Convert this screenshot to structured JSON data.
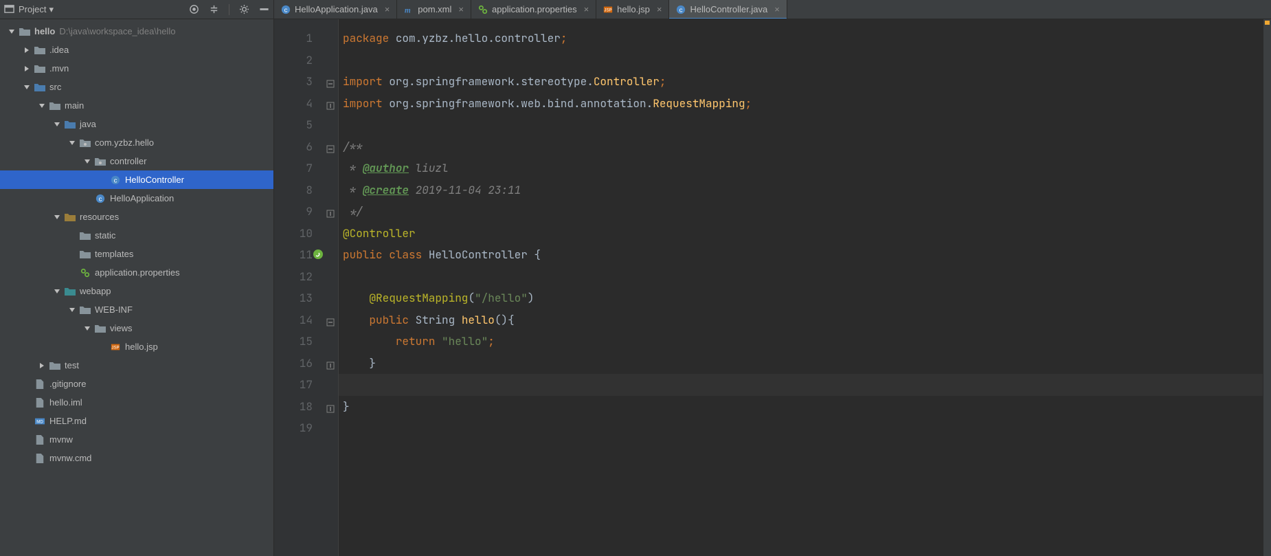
{
  "header": {
    "project_label": "Project",
    "icon_target": "target-icon",
    "icon_collapse": "collapse-icon",
    "icon_settings": "gear-icon",
    "icon_hide": "hide-icon"
  },
  "tabs": [
    {
      "id": "t1",
      "label": "HelloApplication.java",
      "icon": "class",
      "active": false
    },
    {
      "id": "t2",
      "label": "pom.xml",
      "icon": "maven",
      "active": false
    },
    {
      "id": "t3",
      "label": "application.properties",
      "icon": "props",
      "active": false
    },
    {
      "id": "t4",
      "label": "hello.jsp",
      "icon": "jsp",
      "active": false
    },
    {
      "id": "t5",
      "label": "HelloController.java",
      "icon": "class",
      "active": true
    }
  ],
  "tree": [
    {
      "depth": 0,
      "kind": "root",
      "expanded": true,
      "label": "hello",
      "suffix": "D:\\java\\workspace_idea\\hello"
    },
    {
      "depth": 1,
      "kind": "folder",
      "expanded": false,
      "label": ".idea"
    },
    {
      "depth": 1,
      "kind": "folder",
      "expanded": false,
      "label": ".mvn"
    },
    {
      "depth": 1,
      "kind": "src-folder",
      "expanded": true,
      "label": "src"
    },
    {
      "depth": 2,
      "kind": "folder",
      "expanded": true,
      "label": "main"
    },
    {
      "depth": 3,
      "kind": "src-folder",
      "expanded": true,
      "label": "java"
    },
    {
      "depth": 4,
      "kind": "package",
      "expanded": true,
      "label": "com.yzbz.hello"
    },
    {
      "depth": 5,
      "kind": "package",
      "expanded": true,
      "label": "controller"
    },
    {
      "depth": 6,
      "kind": "class",
      "selected": true,
      "label": "HelloController"
    },
    {
      "depth": 5,
      "kind": "class-spring",
      "label": "HelloApplication"
    },
    {
      "depth": 3,
      "kind": "res-folder",
      "expanded": true,
      "label": "resources"
    },
    {
      "depth": 4,
      "kind": "folder",
      "label": "static"
    },
    {
      "depth": 4,
      "kind": "folder",
      "label": "templates"
    },
    {
      "depth": 4,
      "kind": "props",
      "label": "application.properties"
    },
    {
      "depth": 3,
      "kind": "web-folder",
      "expanded": true,
      "label": "webapp"
    },
    {
      "depth": 4,
      "kind": "folder",
      "expanded": true,
      "label": "WEB-INF"
    },
    {
      "depth": 5,
      "kind": "folder",
      "expanded": true,
      "label": "views"
    },
    {
      "depth": 6,
      "kind": "jsp",
      "label": "hello.jsp"
    },
    {
      "depth": 2,
      "kind": "folder",
      "expanded": false,
      "label": "test"
    },
    {
      "depth": 1,
      "kind": "file",
      "label": ".gitignore"
    },
    {
      "depth": 1,
      "kind": "file",
      "label": "hello.iml"
    },
    {
      "depth": 1,
      "kind": "md",
      "label": "HELP.md"
    },
    {
      "depth": 1,
      "kind": "file",
      "label": "mvnw"
    },
    {
      "depth": 1,
      "kind": "file",
      "label": "mvnw.cmd"
    }
  ],
  "editor": {
    "caret_line": 17,
    "lines": [
      {
        "n": 1,
        "segs": [
          {
            "t": "package ",
            "c": "kw"
          },
          {
            "t": "com.yzbz.hello.controller",
            "c": "pkg"
          },
          {
            "t": ";",
            "c": "semi"
          }
        ]
      },
      {
        "n": 2,
        "segs": [
          {
            "t": " ",
            "c": "pkg"
          }
        ]
      },
      {
        "n": 3,
        "fold": "open",
        "segs": [
          {
            "t": "import ",
            "c": "kw"
          },
          {
            "t": "org.springframework.stereotype.",
            "c": "pkg"
          },
          {
            "t": "Controller",
            "c": "type"
          },
          {
            "t": ";",
            "c": "semi"
          }
        ]
      },
      {
        "n": 4,
        "fold": "close",
        "segs": [
          {
            "t": "import ",
            "c": "kw"
          },
          {
            "t": "org.springframework.web.bind.annotation.",
            "c": "pkg"
          },
          {
            "t": "RequestMapping",
            "c": "type"
          },
          {
            "t": ";",
            "c": "semi"
          }
        ]
      },
      {
        "n": 5,
        "segs": [
          {
            "t": " ",
            "c": "pkg"
          }
        ]
      },
      {
        "n": 6,
        "fold": "open",
        "segs": [
          {
            "t": "/**",
            "c": "cmt"
          }
        ]
      },
      {
        "n": 7,
        "segs": [
          {
            "t": " * ",
            "c": "cmt"
          },
          {
            "t": "@author",
            "c": "doc-tag"
          },
          {
            "t": " liuzl",
            "c": "cmt"
          }
        ]
      },
      {
        "n": 8,
        "segs": [
          {
            "t": " * ",
            "c": "cmt"
          },
          {
            "t": "@create",
            "c": "doc-tag"
          },
          {
            "t": " 2019-11-04 23:11",
            "c": "cmt"
          }
        ]
      },
      {
        "n": 9,
        "fold": "close",
        "segs": [
          {
            "t": " */",
            "c": "cmt"
          }
        ]
      },
      {
        "n": 10,
        "segs": [
          {
            "t": "@Controller",
            "c": "ann"
          }
        ]
      },
      {
        "n": 11,
        "bean": true,
        "segs": [
          {
            "t": "public ",
            "c": "kw"
          },
          {
            "t": "class ",
            "c": "kw"
          },
          {
            "t": "HelloController {",
            "c": "cls"
          }
        ]
      },
      {
        "n": 12,
        "segs": [
          {
            "t": " ",
            "c": "pkg"
          }
        ]
      },
      {
        "n": 13,
        "segs": [
          {
            "t": "    ",
            "c": "pkg"
          },
          {
            "t": "@RequestMapping",
            "c": "ann"
          },
          {
            "t": "(",
            "c": "cls"
          },
          {
            "t": "\"/hello\"",
            "c": "str"
          },
          {
            "t": ")",
            "c": "cls"
          }
        ]
      },
      {
        "n": 14,
        "fold": "open",
        "segs": [
          {
            "t": "    ",
            "c": "pkg"
          },
          {
            "t": "public ",
            "c": "kw"
          },
          {
            "t": "String ",
            "c": "cls"
          },
          {
            "t": "hello",
            "c": "type"
          },
          {
            "t": "(){",
            "c": "cls"
          }
        ]
      },
      {
        "n": 15,
        "segs": [
          {
            "t": "        ",
            "c": "pkg"
          },
          {
            "t": "return ",
            "c": "kw"
          },
          {
            "t": "\"hello\"",
            "c": "str"
          },
          {
            "t": ";",
            "c": "semi"
          }
        ]
      },
      {
        "n": 16,
        "fold": "close",
        "segs": [
          {
            "t": "    }",
            "c": "cls"
          }
        ]
      },
      {
        "n": 17,
        "segs": [
          {
            "t": " ",
            "c": "pkg"
          }
        ]
      },
      {
        "n": 18,
        "fold": "close",
        "segs": [
          {
            "t": "}",
            "c": "cls"
          }
        ]
      },
      {
        "n": 19,
        "segs": [
          {
            "t": " ",
            "c": "pkg"
          }
        ]
      }
    ]
  }
}
